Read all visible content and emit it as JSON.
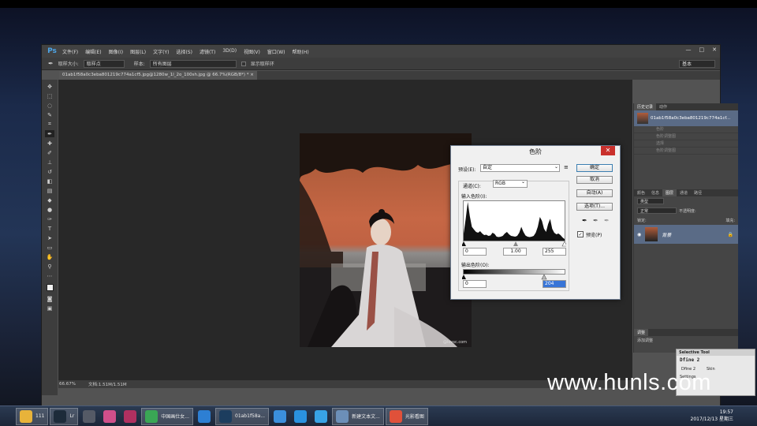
{
  "app": {
    "logo": "Ps",
    "win_buttons": [
      "—",
      "□",
      "✕"
    ]
  },
  "menu": [
    "文件(F)",
    "编辑(E)",
    "图像(I)",
    "图层(L)",
    "文字(Y)",
    "选择(S)",
    "滤镜(T)",
    "3D(D)",
    "视图(V)",
    "窗口(W)",
    "帮助(H)"
  ],
  "options_bar": {
    "sample_label": "取样大小:",
    "sample_value": "取样点",
    "sample_from_label": "样本:",
    "sample_from_value": "所有图层",
    "show_ring": "显示取样环",
    "workspace": "基本"
  },
  "document_tab": "01ab1f58a0c3eba801219c774a1cf5.jpg@1280w_1l_2o_100sh.jpg @ 66.7%(RGB/8*) * ×",
  "status": {
    "zoom": "66.67%",
    "doc_size": "文档:1.51M/1.51M"
  },
  "photo_credit": "@lovsc.com",
  "history_panel": {
    "tabs": [
      "历史记录",
      "动作"
    ],
    "snapshot": "01ab1f58a0c3eba801219c774a1cf...",
    "items": [
      "色阶",
      "色阶调整图",
      "选择",
      "色阶调整图"
    ]
  },
  "layers_panel": {
    "tabs": [
      "颜色",
      "信息",
      "图层",
      "通道",
      "路径"
    ],
    "filter": "类型",
    "blend": "正常",
    "opacity_label": "不透明度:",
    "lock_label": "锁定:",
    "fill_label": "填充:",
    "layer_name": "背景"
  },
  "adjust_panel": {
    "tab": "调整",
    "label": "添加调整"
  },
  "levels_dialog": {
    "title": "色阶",
    "close": "✕",
    "preset_label": "预设(E):",
    "preset_value": "自定",
    "channel_label": "通道(C):",
    "channel_value": "RGB",
    "input_label": "输入色阶(I):",
    "input_black": "0",
    "input_gamma": "1.00",
    "input_white": "255",
    "output_label": "输出色阶(O):",
    "output_black": "0",
    "output_white": "204",
    "buttons": {
      "ok": "确定",
      "cancel": "取消",
      "auto": "自动(A)",
      "options": "选项(T)..."
    },
    "preview": "预览(P)",
    "preview_checked": true,
    "histogram": [
      0.18,
      0.55,
      0.98,
      0.62,
      0.35,
      0.28,
      0.22,
      0.2,
      0.24,
      0.18,
      0.14,
      0.15,
      0.12,
      0.13,
      0.2,
      0.17,
      0.1,
      0.09,
      0.1,
      0.12,
      0.18,
      0.22,
      0.16,
      0.12,
      0.11,
      0.1,
      0.12,
      0.2,
      0.35,
      0.22,
      0.13,
      0.1,
      0.09,
      0.1,
      0.12,
      0.2,
      0.35,
      0.6,
      0.5,
      0.3,
      0.22,
      0.42,
      0.55,
      0.3,
      0.2,
      0.16,
      0.18,
      0.14,
      0.08,
      0.04
    ]
  },
  "float_window": {
    "title": "Selective Tool",
    "item1": "Dfine 2",
    "item2": "Dfine 2",
    "item3": "Skin",
    "settings": "Settings"
  },
  "taskbar": {
    "items": [
      {
        "icon": "folder-icon",
        "label": "111",
        "color": "#e8b33a"
      },
      {
        "icon": "lightroom-icon",
        "label": "Lr",
        "color": "#1d2b3a"
      },
      {
        "icon": "printer-icon",
        "label": "",
        "color": "#555a66"
      },
      {
        "icon": "pinwheel-icon",
        "label": "",
        "color": "#d04f8a"
      },
      {
        "icon": "app-icon",
        "label": "",
        "color": "#b03060"
      },
      {
        "icon": "browser-icon",
        "label": "中国画仕女...",
        "color": "#3aa655"
      },
      {
        "icon": "bird-icon",
        "label": "",
        "color": "#2d7fd3"
      },
      {
        "icon": "photoshop-icon",
        "label": "01ab1f58a...",
        "color": "#1c3d5e"
      },
      {
        "icon": "ie-icon",
        "label": "",
        "color": "#3b8fdc"
      },
      {
        "icon": "sync-icon",
        "label": "",
        "color": "#2a92e0"
      },
      {
        "icon": "cloud-icon",
        "label": "",
        "color": "#38a3e6"
      },
      {
        "icon": "notepad-icon",
        "label": "新建文本文...",
        "color": "#6c8fb8"
      },
      {
        "icon": "photo-viewer-icon",
        "label": "光影看图",
        "color": "#e0513a"
      }
    ],
    "clock": "19:57",
    "date": "2017/12/13 星期三"
  },
  "watermark": "www.hunls.com"
}
